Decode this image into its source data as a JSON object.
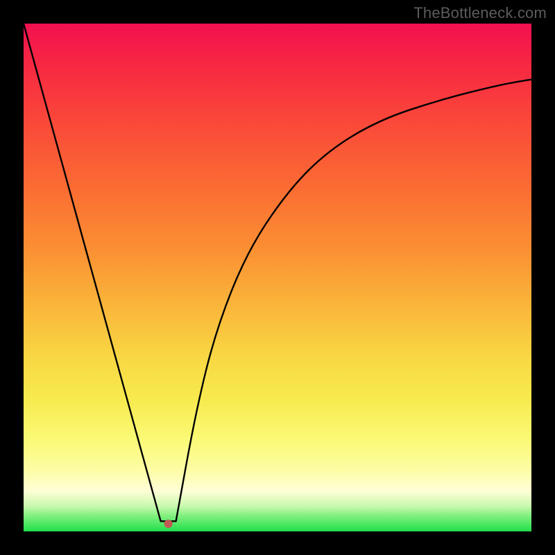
{
  "watermark": "TheBottleneck.com",
  "chart_data": {
    "type": "line",
    "title": "",
    "xlabel": "",
    "ylabel": "",
    "xlim": [
      0,
      100
    ],
    "ylim": [
      0,
      100
    ],
    "grid": false,
    "legend": false,
    "series": [
      {
        "name": "left-segment",
        "x": [
          0,
          27
        ],
        "y": [
          100,
          2
        ]
      },
      {
        "name": "valley-floor",
        "x": [
          27,
          30
        ],
        "y": [
          2,
          2
        ]
      },
      {
        "name": "right-segment",
        "x": [
          30,
          34,
          38,
          44,
          52,
          60,
          70,
          82,
          94,
          100
        ],
        "y": [
          2,
          24,
          40,
          55,
          67,
          75,
          81,
          85,
          88,
          89
        ]
      }
    ],
    "marker": {
      "x": 28.5,
      "y": 1.5,
      "color": "#c05a55"
    },
    "gradient_stops": [
      {
        "pos": 0,
        "color": "#f2104f"
      },
      {
        "pos": 9,
        "color": "#f72a41"
      },
      {
        "pos": 20,
        "color": "#fa4a39"
      },
      {
        "pos": 32,
        "color": "#fb6b33"
      },
      {
        "pos": 44,
        "color": "#fb8e33"
      },
      {
        "pos": 56,
        "color": "#fab73a"
      },
      {
        "pos": 66,
        "color": "#f8d844"
      },
      {
        "pos": 74,
        "color": "#f7ea4f"
      },
      {
        "pos": 82,
        "color": "#fbfa76"
      },
      {
        "pos": 88,
        "color": "#fdfda6"
      },
      {
        "pos": 92,
        "color": "#fefed6"
      },
      {
        "pos": 95,
        "color": "#c9f9af"
      },
      {
        "pos": 97,
        "color": "#7fef7d"
      },
      {
        "pos": 99,
        "color": "#3fe55c"
      },
      {
        "pos": 100,
        "color": "#21dd4e"
      }
    ]
  }
}
